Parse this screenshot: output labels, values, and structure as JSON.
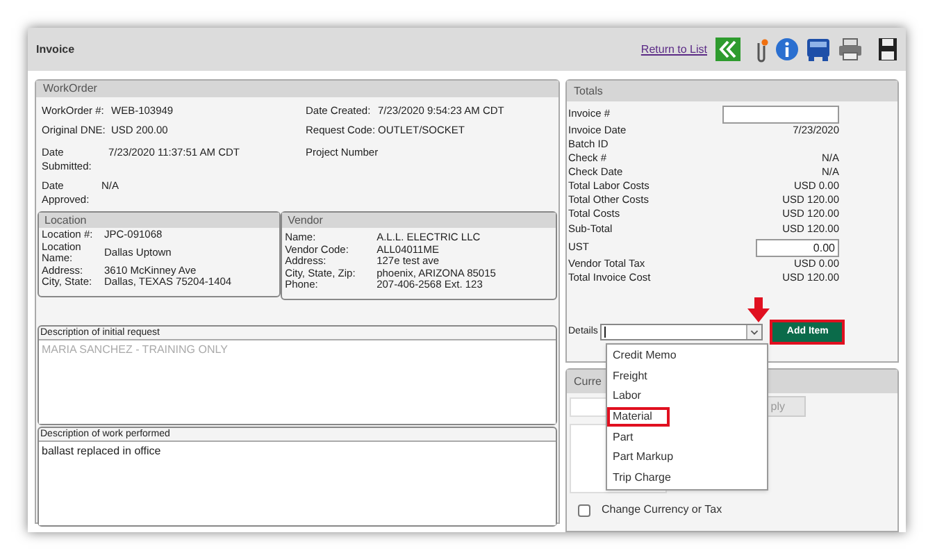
{
  "window": {
    "title": "Invoice",
    "return_link": "Return to List"
  },
  "workorder": {
    "title": "WorkOrder",
    "left_fields": [
      {
        "label": "WorkOrder #:",
        "value": "WEB-103949"
      },
      {
        "label": "Original DNE:",
        "value": "USD 200.00"
      }
    ],
    "right_fields": [
      {
        "label": "Date Created:",
        "value": "7/23/2020 9:54:23 AM CDT"
      },
      {
        "label": "Request Code:",
        "value": "OUTLET/SOCKET"
      }
    ],
    "left_fields_2": [
      {
        "label": "Date Submitted:",
        "value": "7/23/2020 11:37:51 AM CDT"
      },
      {
        "label": "Date Approved:",
        "value": "N/A"
      }
    ],
    "project_label": "Project Number"
  },
  "location": {
    "title": "Location",
    "fields": [
      {
        "label": "Location #:",
        "value": "JPC-091068"
      },
      {
        "label": "Location Name:",
        "value": "Dallas Uptown"
      },
      {
        "label": "Address:",
        "value": "3610 McKinney Ave"
      },
      {
        "label": "City, State:",
        "value": "Dallas, TEXAS 75204-1404"
      }
    ]
  },
  "vendor": {
    "title": "Vendor",
    "fields": [
      {
        "label": "Name:",
        "value": "A.L.L. ELECTRIC LLC"
      },
      {
        "label": "Vendor Code:",
        "value": "ALL04011ME"
      },
      {
        "label": "Address:",
        "value": "127e test ave"
      },
      {
        "label": "City, State, Zip:",
        "value": "phoenix, ARIZONA 85015"
      },
      {
        "label": "Phone:",
        "value": "207-406-2568 Ext. 123"
      }
    ]
  },
  "initial_request": {
    "label": "Description of initial request",
    "value": "MARIA SANCHEZ - TRAINING ONLY"
  },
  "work_performed": {
    "label": "Description of work performed",
    "value": "ballast replaced in office"
  },
  "totals": {
    "title": "Totals",
    "rows": [
      {
        "label": "Invoice #",
        "kind": "input"
      },
      {
        "label": "Invoice Date",
        "value": "7/23/2020",
        "kind": "text"
      },
      {
        "label": "Batch ID",
        "kind": "text"
      },
      {
        "label": "Check #",
        "value": "N/A",
        "kind": "text"
      },
      {
        "label": "Check Date",
        "value": "N/A",
        "kind": "text"
      },
      {
        "label": "Total Labor Costs",
        "value": "USD 0.00",
        "kind": "text"
      },
      {
        "label": "Total Other Costs",
        "value": "USD 120.00",
        "kind": "text"
      },
      {
        "label": "Total Costs",
        "value": "USD 120.00",
        "kind": "text"
      },
      {
        "label": "Sub-Total",
        "value": "USD 120.00",
        "kind": "text"
      },
      {
        "label": "UST",
        "value": "0.00",
        "kind": "input"
      },
      {
        "label": "Vendor Total Tax",
        "value": "USD 0.00",
        "kind": "text"
      },
      {
        "label": "Total Invoice Cost",
        "value": "USD 120.00",
        "kind": "text"
      }
    ],
    "details_label": "Details",
    "add_button": "Add Item",
    "options": [
      {
        "label": "Credit Memo",
        "highlighted": false
      },
      {
        "label": "Freight",
        "highlighted": false
      },
      {
        "label": "Labor",
        "highlighted": false
      },
      {
        "label": "Material",
        "highlighted": true
      },
      {
        "label": "Part",
        "highlighted": false
      },
      {
        "label": "Part Markup",
        "highlighted": false
      },
      {
        "label": "Trip Charge",
        "highlighted": false
      }
    ]
  },
  "currency": {
    "title": "Curre",
    "apply_button": "ply",
    "checkbox": {
      "label": "Change Currency or Tax",
      "checked": false
    }
  }
}
